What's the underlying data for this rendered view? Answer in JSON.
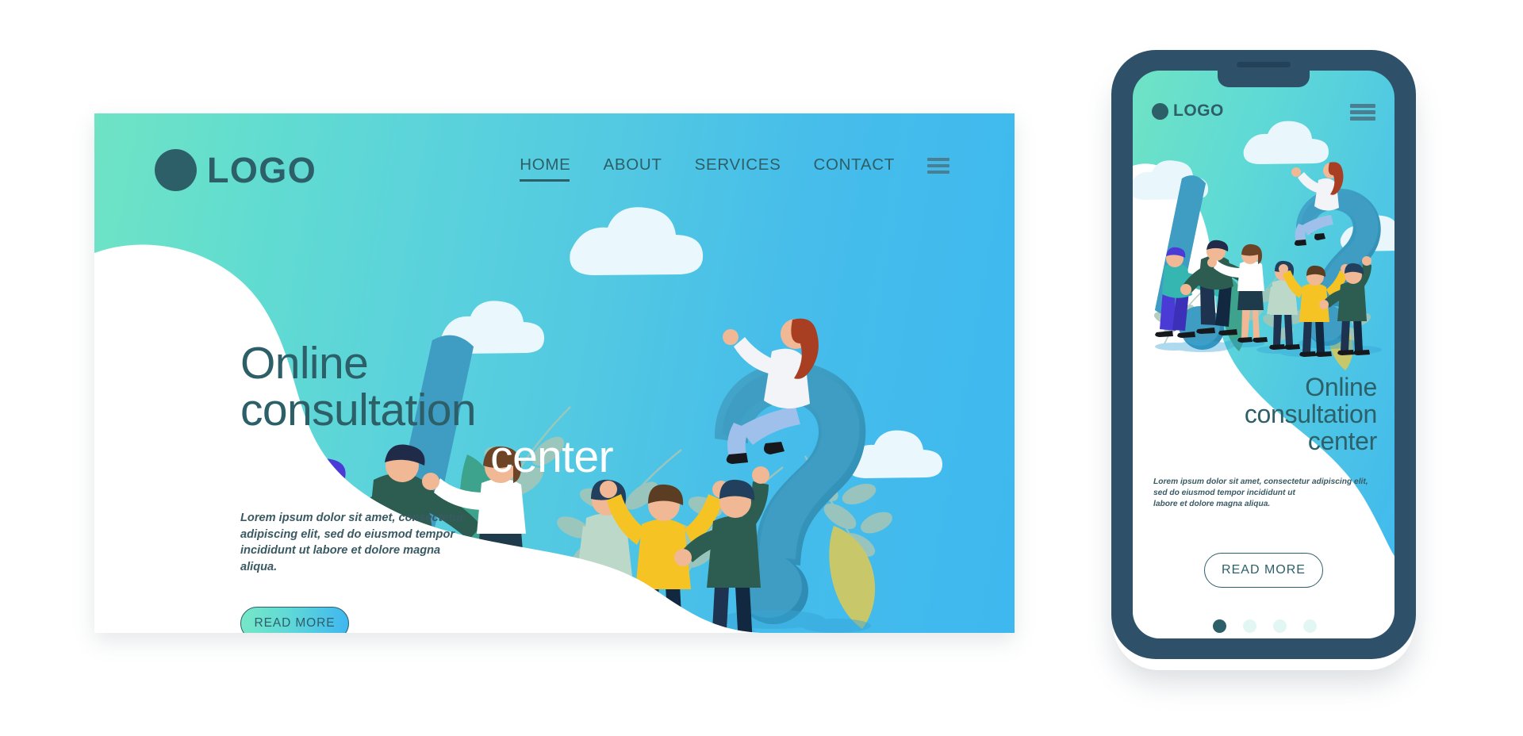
{
  "brand": {
    "logo_text": "LOGO",
    "logo_icon": "circle-icon"
  },
  "colors": {
    "mint": "#6fe3c4",
    "sky": "#3eb8ef",
    "dark_teal": "#2d5f68",
    "phone_bezel": "#2e5068",
    "dot_inactive": "#c9f1ea",
    "white": "#ffffff"
  },
  "desktop": {
    "nav": {
      "items": [
        {
          "label": "HOME",
          "active": true
        },
        {
          "label": "ABOUT",
          "active": false
        },
        {
          "label": "SERVICES",
          "active": false
        },
        {
          "label": "CONTACT",
          "active": false
        }
      ],
      "menu_icon": "hamburger-icon"
    },
    "hero": {
      "headline_line1": "Online",
      "headline_line2": "consultation",
      "headline_line3": "center",
      "paragraph": "Lorem ipsum dolor sit amet, consectetur adipiscing elit, sed do eiusmod tempor incididunt ut labore et dolore magna aliqua.",
      "paragraph_lines": [
        "Lorem ipsum dolor sit amet, consectetur adipiscing elit,",
        "sed do eiusmod tempor incididunt ut",
        "labore et dolore magna aliqua."
      ],
      "cta_label": "READ MORE",
      "carousel": {
        "total": 4,
        "active_index": 0
      }
    },
    "illustration": {
      "name": "online-consultation-illustration",
      "elements": [
        "exclamation-mark",
        "question-mark",
        "clouds",
        "foliage-leaves",
        "people-group"
      ]
    }
  },
  "mobile": {
    "nav": {
      "menu_icon": "hamburger-icon"
    },
    "hero": {
      "headline_line1": "Online",
      "headline_line2": "consultation",
      "headline_line3": "center",
      "paragraph_lines": [
        "Lorem ipsum dolor sit amet, consectetur adipiscing elit,",
        "sed do eiusmod tempor incididunt ut",
        "labore et dolore magna aliqua."
      ],
      "cta_label": "READ MORE",
      "carousel": {
        "total": 4,
        "active_index": 0
      }
    }
  }
}
